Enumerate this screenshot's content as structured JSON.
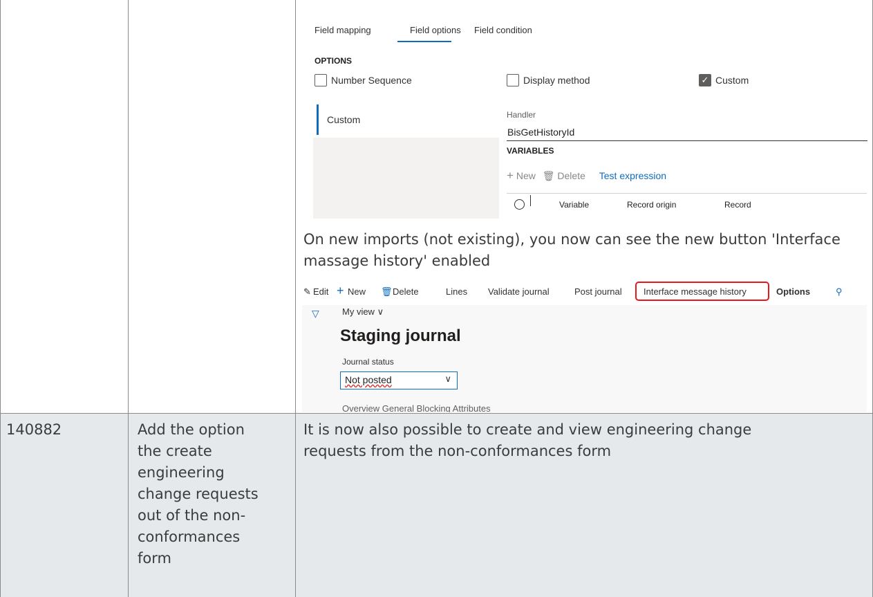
{
  "screenshot1": {
    "tabs": [
      "Field mapping",
      "Field options",
      "Field condition"
    ],
    "options_title": "OPTIONS",
    "checkboxes": [
      {
        "label": "Number Sequence",
        "checked": false
      },
      {
        "label": "Display method",
        "checked": false
      },
      {
        "label": "Custom",
        "checked": true
      }
    ],
    "left_item": "Custom",
    "handler_label": "Handler",
    "handler_value": "BisGetHistoryId",
    "variables_title": "VARIABLES",
    "var_actions": {
      "new": "New",
      "delete": "Delete",
      "test": "Test expression"
    },
    "grid_columns": [
      "Variable",
      "Record origin",
      "Record"
    ]
  },
  "row1_text": "On new imports (not existing), you now can see the new button 'Interface massage history' enabled",
  "screenshot2": {
    "toolbar": [
      "Edit",
      "New",
      "Delete",
      "Lines",
      "Validate journal",
      "Post journal",
      "Interface message history",
      "Options"
    ],
    "my_view": "My view",
    "title": "Staging journal",
    "status_label": "Journal status",
    "status_value": "Not posted",
    "bottom_tabs": "Overview    General    Blocking    Attributes"
  },
  "row2": {
    "id": "140882",
    "description": "Add the option the create engineering change requests out of the non-conformances form",
    "description_lines": [
      "Add the option",
      "the create",
      "engineering",
      "change requests",
      "out of the non-",
      "conformances",
      "form"
    ],
    "detail_lines": [
      "It is now also possible to create and view engineering change",
      "requests from the non-conformances form"
    ]
  },
  "colors": {
    "accent": "#0f6cbd",
    "highlight": "#e8151c",
    "row_bg": "#e6e9ec"
  }
}
